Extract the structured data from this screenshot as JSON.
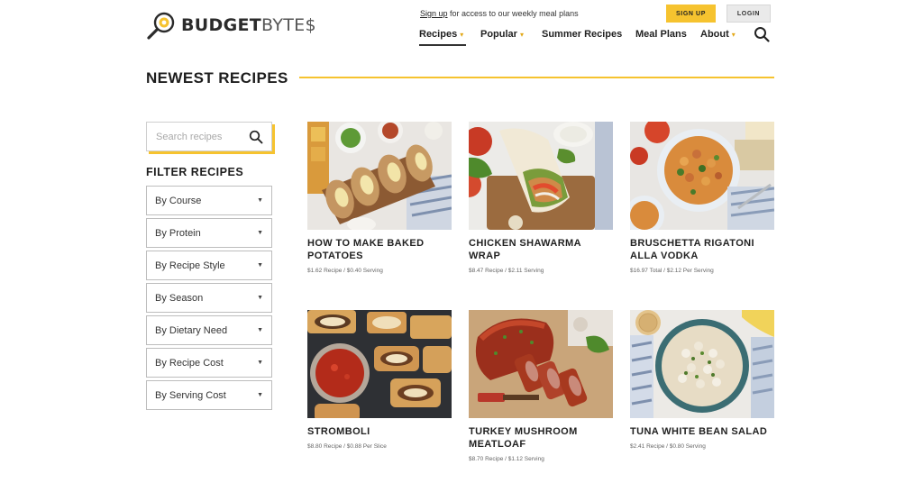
{
  "header": {
    "logo_main": "BUDGET",
    "logo_accent": "BYTE$",
    "promo_link": "Sign up",
    "promo_text": " for access to our weekly meal plans",
    "signup_label": "SIGN UP",
    "login_label": "LOGIN"
  },
  "nav": {
    "items": [
      {
        "label": "Recipes",
        "has_dropdown": true,
        "active": true
      },
      {
        "label": "Popular",
        "has_dropdown": true
      },
      {
        "label": "Summer Recipes",
        "has_dropdown": false
      },
      {
        "label": "Meal Plans",
        "has_dropdown": false
      },
      {
        "label": "About",
        "has_dropdown": true
      }
    ],
    "search_icon": "search-icon"
  },
  "section": {
    "title": "NEWEST RECIPES"
  },
  "sidebar": {
    "search_placeholder": "Search recipes",
    "filter_title": "FILTER RECIPES",
    "filters": [
      {
        "label": "By Course"
      },
      {
        "label": "By Protein"
      },
      {
        "label": "By Recipe Style"
      },
      {
        "label": "By Season"
      },
      {
        "label": "By Dietary Need"
      },
      {
        "label": "By Recipe Cost"
      },
      {
        "label": "By Serving Cost"
      }
    ]
  },
  "recipes": [
    {
      "title": "HOW TO MAKE BAKED POTATOES",
      "cost": "$1.62 Recipe / $0.40 Serving"
    },
    {
      "title": "CHICKEN SHAWARMA WRAP",
      "cost": "$8.47 Recipe / $2.11 Serving"
    },
    {
      "title": "BRUSCHETTA RIGATONI ALLA VODKA",
      "cost": "$16.97 Total / $2.12 Per Serving"
    },
    {
      "title": "STROMBOLI",
      "cost": "$8.80 Recipe / $0.88 Per Slice"
    },
    {
      "title": "TURKEY MUSHROOM MEATLOAF",
      "cost": "$8.70 Recipe / $1.12 Serving"
    },
    {
      "title": "TUNA WHITE BEAN SALAD",
      "cost": "$2.41 Recipe / $0.80 Serving"
    }
  ],
  "colors": {
    "accent": "#f6c32f",
    "text": "#222222",
    "login_bg": "#eaeaea"
  }
}
